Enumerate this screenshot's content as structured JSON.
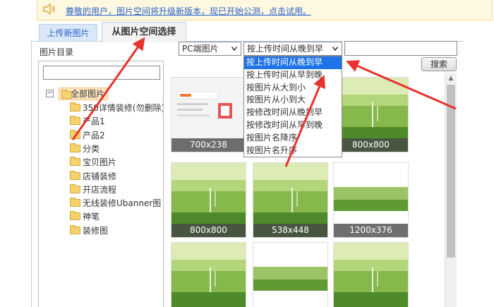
{
  "notice": {
    "icon": "speaker-icon",
    "text": "尊敬的用户，图片空间将升级新版本，现已开始公测，点击试用。"
  },
  "tabs": {
    "upload_label": "上传新图片",
    "select_label": "从图片空间选择"
  },
  "directory": {
    "title": "图片目录",
    "search_value": "",
    "root": {
      "toggle": "−",
      "label": "全部图片"
    },
    "items": [
      "350详情装修(勿删除)",
      "产品1",
      "产品2",
      "分类",
      "宝贝图片",
      "店铺装修",
      "开店流程",
      "无线装修Ubanner图",
      "神笔",
      "装修图"
    ]
  },
  "toolbar": {
    "source_value": "PC端图片",
    "sort_value": "按上传时间从晚到早",
    "keyword_value": "",
    "search_label": "搜索"
  },
  "sort_options": {
    "items": [
      "按上传时间从晚到早",
      "按上传时间从早到晚",
      "按图片从大到小",
      "按图片从小到大",
      "按修改时间从晚到早",
      "按修改时间从早到晚",
      "按图片名降序",
      "按图片名升序"
    ],
    "selected_index": 0
  },
  "thumbnails": [
    {
      "caption": "700x238"
    },
    {
      "caption": ""
    },
    {
      "caption": "800x800"
    },
    {
      "caption": "800x800"
    },
    {
      "caption": "538x448"
    },
    {
      "caption": "1200x376"
    },
    {
      "caption": ""
    },
    {
      "caption": ""
    },
    {
      "caption": ""
    }
  ],
  "colors": {
    "accent": "#1e73e8",
    "annotation_arrow": "#e8322d",
    "notice_bg": "#fff8e1",
    "link": "#2a62c9"
  }
}
